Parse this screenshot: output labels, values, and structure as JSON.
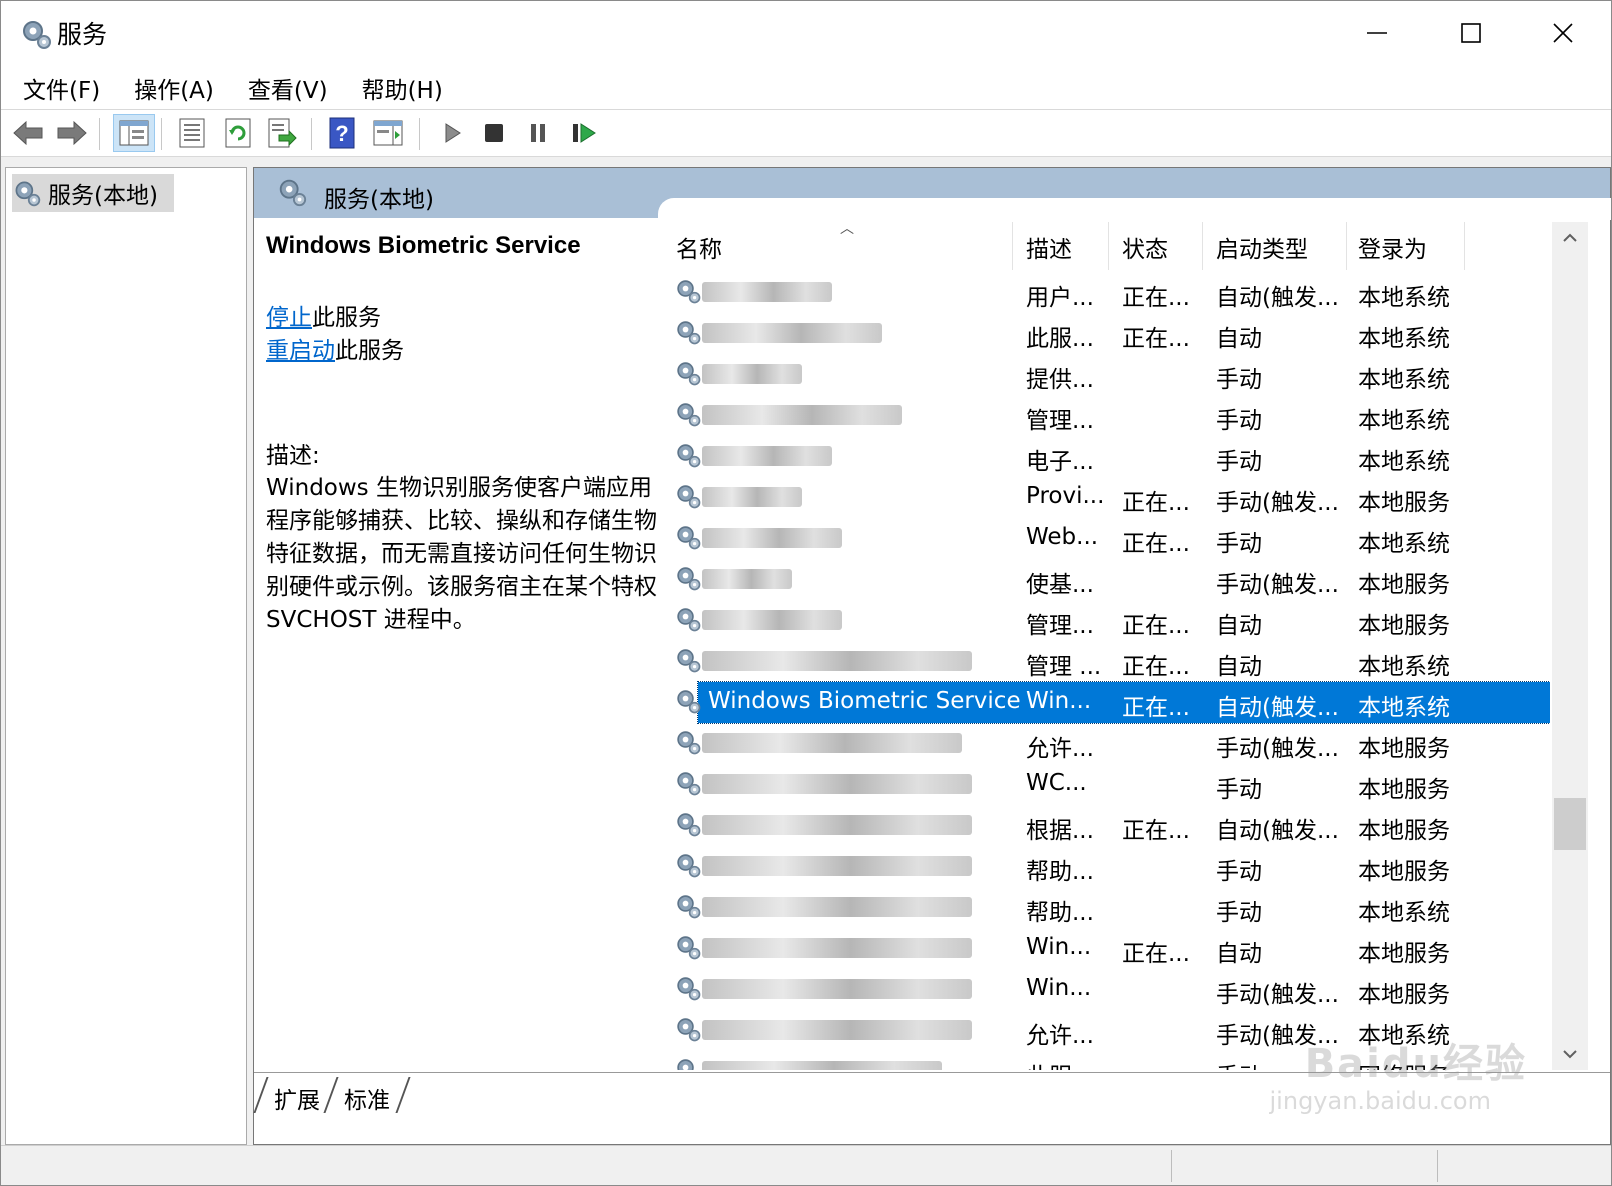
{
  "window": {
    "title": "服务"
  },
  "menu": [
    "文件(F)",
    "操作(A)",
    "查看(V)",
    "帮助(H)"
  ],
  "tree": {
    "root_label": "服务(本地)"
  },
  "panel": {
    "header": "服务(本地)"
  },
  "description": {
    "service_name": "Windows Biometric Service",
    "stop_link": "停止",
    "stop_suffix": "此服务",
    "restart_link": "重启动",
    "restart_suffix": "此服务",
    "label": "描述:",
    "text": "Windows 生物识别服务使客户端应用程序能够捕获、比较、操纵和存储生物特征数据，而无需直接访问任何生物识别硬件或示例。该服务宿主在某个特权 SVCHOST 进程中。"
  },
  "columns": [
    "名称",
    "描述",
    "状态",
    "启动类型",
    "登录为"
  ],
  "rows": [
    {
      "name": "",
      "desc": "用户...",
      "status": "正在...",
      "startup": "自动(触发...",
      "logon": "本地系统"
    },
    {
      "name": "",
      "desc": "此服...",
      "status": "正在...",
      "startup": "自动",
      "logon": "本地系统"
    },
    {
      "name": "",
      "desc": "提供...",
      "status": "",
      "startup": "手动",
      "logon": "本地系统"
    },
    {
      "name": "",
      "desc": "管理...",
      "status": "",
      "startup": "手动",
      "logon": "本地系统"
    },
    {
      "name": "",
      "desc": "电子...",
      "status": "",
      "startup": "手动",
      "logon": "本地系统"
    },
    {
      "name": "",
      "desc": "Provi...",
      "status": "正在...",
      "startup": "手动(触发...",
      "logon": "本地服务"
    },
    {
      "name": "",
      "desc": "Web...",
      "status": "正在...",
      "startup": "手动",
      "logon": "本地系统"
    },
    {
      "name": "",
      "desc": "使基...",
      "status": "",
      "startup": "手动(触发...",
      "logon": "本地服务"
    },
    {
      "name": "",
      "desc": "管理...",
      "status": "正在...",
      "startup": "自动",
      "logon": "本地服务"
    },
    {
      "name": "",
      "desc": "管理 ...",
      "status": "正在...",
      "startup": "自动",
      "logon": "本地系统"
    },
    {
      "name": "Windows Biometric Service",
      "desc": "Win...",
      "status": "正在...",
      "startup": "自动(触发...",
      "logon": "本地系统",
      "selected": true
    },
    {
      "name": "",
      "desc": "允许...",
      "status": "",
      "startup": "手动(触发...",
      "logon": "本地服务"
    },
    {
      "name": "",
      "desc": "WC...",
      "status": "",
      "startup": "手动",
      "logon": "本地服务"
    },
    {
      "name": "",
      "desc": "根据...",
      "status": "正在...",
      "startup": "自动(触发...",
      "logon": "本地服务"
    },
    {
      "name": "",
      "desc": "帮助...",
      "status": "",
      "startup": "手动",
      "logon": "本地服务"
    },
    {
      "name": "",
      "desc": "帮助...",
      "status": "",
      "startup": "手动",
      "logon": "本地系统"
    },
    {
      "name": "",
      "desc": "Win...",
      "status": "正在...",
      "startup": "自动",
      "logon": "本地服务"
    },
    {
      "name": "",
      "desc": "Win...",
      "status": "",
      "startup": "手动(触发...",
      "logon": "本地服务"
    },
    {
      "name": "",
      "desc": "允许...",
      "status": "",
      "startup": "手动(触发...",
      "logon": "本地系统"
    },
    {
      "name": "",
      "desc": "此服...",
      "status": "",
      "startup": "手动",
      "logon": "网络服务"
    }
  ],
  "tabs": [
    "扩展",
    "标准"
  ],
  "watermark": {
    "brand": "Baidu经验",
    "url": "jingyan.baidu.com"
  },
  "colors": {
    "selection": "#0078d7",
    "header": "#a9bfd6",
    "link": "#0066cc"
  }
}
